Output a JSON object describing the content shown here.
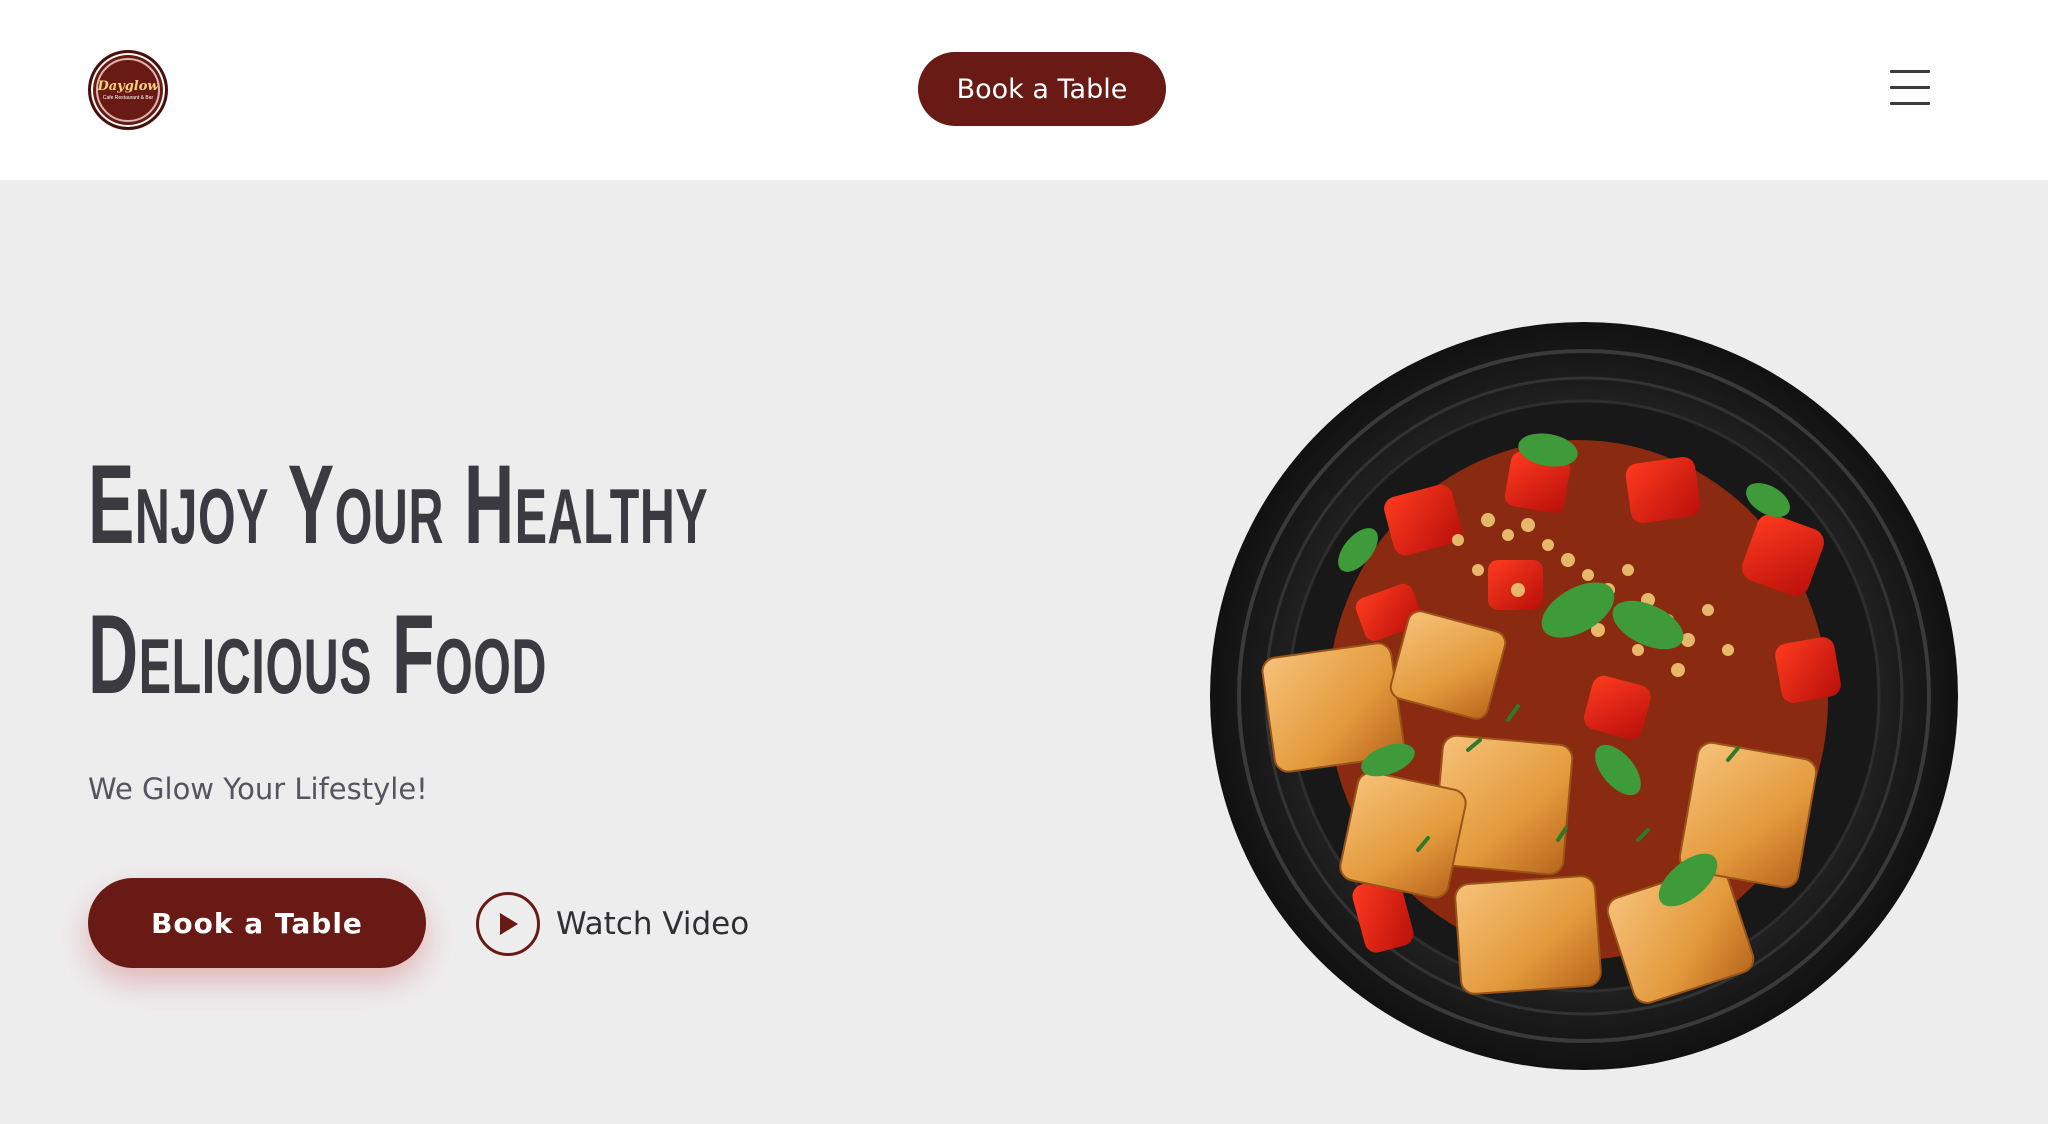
{
  "header": {
    "logo": {
      "name": "Dayglow",
      "subtitle": "Cafe Restaurant & Bar"
    },
    "book_button": "Book a Table",
    "menu_icon": "hamburger-menu-icon"
  },
  "hero": {
    "headline_line1": "Enjoy Your Healthy",
    "headline_line2": "Delicious Food",
    "tagline": "We Glow Your Lifestyle!",
    "book_button": "Book a Table",
    "watch_video": "Watch Video",
    "play_icon": "play-icon",
    "image": "plate of spicy tofu with peppers, herbs and peanuts"
  },
  "colors": {
    "brand": "#6a1a14",
    "hero_bg": "#eeedee",
    "header_bg": "#ffffff",
    "headline": "#3a3a40"
  }
}
